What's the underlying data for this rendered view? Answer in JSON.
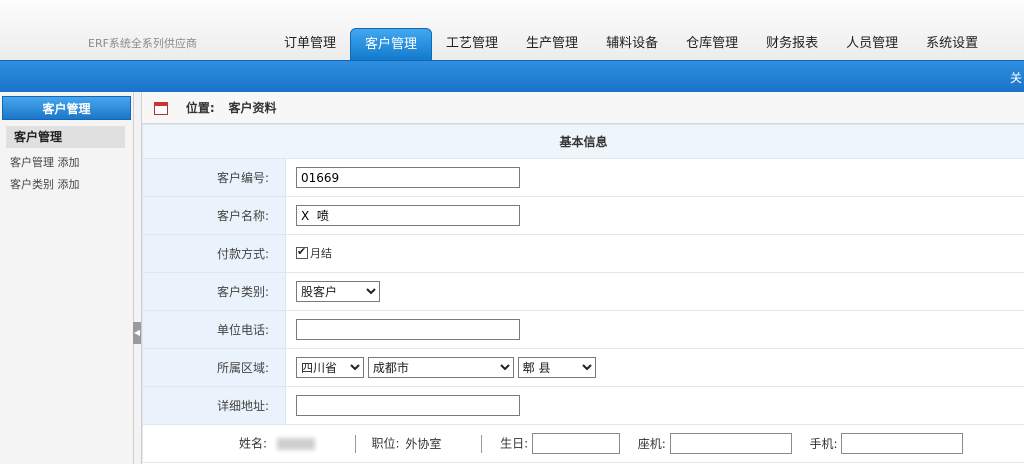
{
  "header": {
    "brand": "ERF系统全系列供应商",
    "tabs": [
      {
        "label": "订单管理",
        "active": false
      },
      {
        "label": "客户管理",
        "active": true
      },
      {
        "label": "工艺管理",
        "active": false
      },
      {
        "label": "生产管理",
        "active": false
      },
      {
        "label": "辅料设备",
        "active": false
      },
      {
        "label": "仓库管理",
        "active": false
      },
      {
        "label": "财务报表",
        "active": false
      },
      {
        "label": "人员管理",
        "active": false
      },
      {
        "label": "系统设置",
        "active": false
      }
    ],
    "bar_text": "关"
  },
  "sidebar": {
    "title": "客户管理",
    "group": "客户管理",
    "items": [
      {
        "label": "客户管理",
        "action": "添加"
      },
      {
        "label": "客户类别",
        "action": "添加"
      }
    ]
  },
  "location": {
    "label": "位置:",
    "value": "客户资料"
  },
  "form": {
    "section_title": "基本信息",
    "customer_no": {
      "label": "客户编号:",
      "value": "01669"
    },
    "customer_name": {
      "label": "客户名称:",
      "value": "X  喷"
    },
    "payment": {
      "label": "付款方式:",
      "option": "月结",
      "checked": true
    },
    "category": {
      "label": "客户类别:",
      "value": "股客户"
    },
    "phone": {
      "label": "单位电话:",
      "value": ""
    },
    "region": {
      "label": "所属区域:",
      "province": "四川省",
      "city": "成都市",
      "county": "郫  县"
    },
    "address": {
      "label": "详细地址:",
      "value": ""
    },
    "contact": {
      "name_label": "姓名:",
      "position_label": "职位:",
      "position_value": "外协室",
      "birthday_label": "生日:",
      "landline_label": "座机:",
      "mobile_label": "手机:"
    }
  },
  "colors": {
    "accent_blue": "#1a73c8",
    "label_bg": "#eaf3fb"
  }
}
